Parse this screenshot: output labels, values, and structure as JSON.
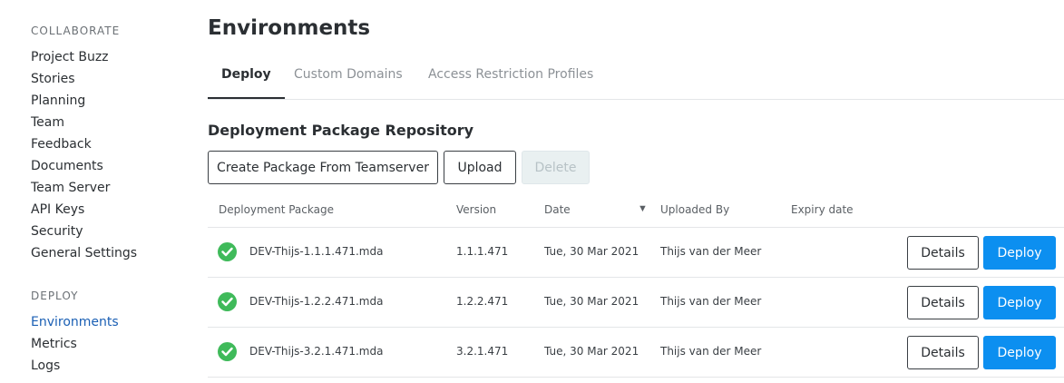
{
  "sidebar": {
    "collaborate_title": "COLLABORATE",
    "collaborate_items": [
      "Project Buzz",
      "Stories",
      "Planning",
      "Team",
      "Feedback",
      "Documents",
      "Team Server",
      "API Keys",
      "Security",
      "General Settings"
    ],
    "deploy_title": "DEPLOY",
    "deploy_items": [
      "Environments",
      "Metrics",
      "Logs"
    ],
    "active_item": "Environments"
  },
  "main": {
    "title": "Environments",
    "tabs": [
      "Deploy",
      "Custom Domains",
      "Access Restriction Profiles"
    ],
    "active_tab": "Deploy",
    "section_heading": "Deployment Package Repository",
    "buttons": {
      "create": "Create Package From Teamserver",
      "upload": "Upload",
      "delete": "Delete"
    },
    "table": {
      "headers": [
        "Deployment Package",
        "Version",
        "Date",
        "Uploaded By",
        "Expiry date"
      ],
      "sort_icon": "sort-desc-icon",
      "rows": [
        {
          "package": "DEV-Thijs-1.1.1.471.mda",
          "version": "1.1.1.471",
          "date": "Tue, 30 Mar 2021",
          "uploaded_by": "Thijs van der Meer",
          "expiry": "",
          "details_label": "Details",
          "deploy_label": "Deploy"
        },
        {
          "package": "DEV-Thijs-1.2.2.471.mda",
          "version": "1.2.2.471",
          "date": "Tue, 30 Mar 2021",
          "uploaded_by": "Thijs van der Meer",
          "expiry": "",
          "details_label": "Details",
          "deploy_label": "Deploy"
        },
        {
          "package": "DEV-Thijs-3.2.1.471.mda",
          "version": "3.2.1.471",
          "date": "Tue, 30 Mar 2021",
          "uploaded_by": "Thijs van der Meer",
          "expiry": "",
          "details_label": "Details",
          "deploy_label": "Deploy"
        }
      ]
    }
  },
  "colors": {
    "accent": "#0c8ff0",
    "success": "#3fba5a",
    "active_nav": "#1a5fb4"
  }
}
